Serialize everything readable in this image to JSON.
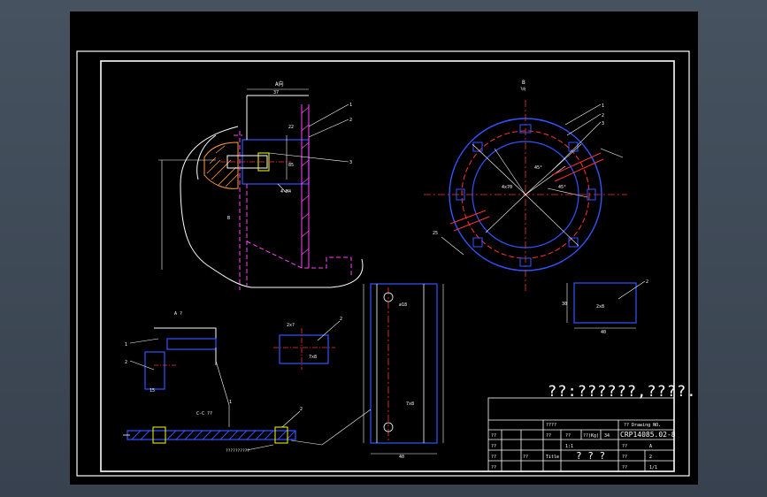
{
  "drawing": {
    "view_labels": {
      "view_a": "A向",
      "view_b": "B",
      "view_b_sub": "?向",
      "view_b_detail": "B",
      "view_aa": "A ?",
      "section_cc": "C-C ??"
    },
    "dimensions": {
      "d1": "37",
      "d2": "22",
      "d3": "85",
      "d4": "45°",
      "d5": "4x70",
      "d6": "3",
      "d7": "2",
      "d8": "1",
      "d9": "45°",
      "d10": "4-M4",
      "d11": "25",
      "d12": "2x?",
      "d13": "∅18",
      "d14": "7x8",
      "d15": "40",
      "d16": "7x8",
      "d17": "??????????",
      "d18": "2",
      "d19": "30",
      "d20": "70",
      "d21": "2x8",
      "d22": "40",
      "d23": "50",
      "d24": "25",
      "d25": "15"
    },
    "leaders": [
      "1",
      "2",
      "3",
      "4"
    ],
    "technical_note": "??:??????,????."
  },
  "title_block": {
    "drawing_no_label": "?? Drawing NO.",
    "drawing_no": "CRP14085.02-8",
    "cells": {
      "r1c1": "????",
      "scale_label": "??",
      "scale_value": "1:1",
      "mark": "??",
      "count": "34",
      "weight_label": "??",
      "title": "? ? ?",
      "rev": "A",
      "sheet": "2",
      "sheets": "1/1",
      "design": "??",
      "check": "??",
      "process": "??",
      "approve": "??",
      "date": "??",
      "name1": "??",
      "name2": "??",
      "t1": "??(Kg)",
      "t2": "??",
      "t3": "??",
      "title_label": "Title"
    }
  }
}
